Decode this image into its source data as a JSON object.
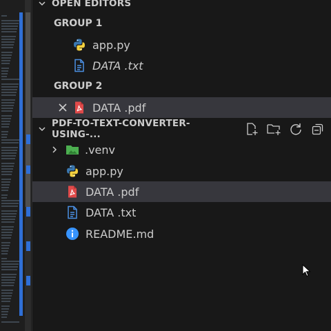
{
  "open_editors": {
    "title": "OPEN EDITORS",
    "groups": [
      {
        "label": "GROUP 1",
        "files": [
          {
            "name": "app.py"
          },
          {
            "name": "DATA .txt"
          }
        ]
      },
      {
        "label": "GROUP 2",
        "files": [
          {
            "name": "DATA .pdf"
          }
        ]
      }
    ]
  },
  "project": {
    "title": "PDF-TO-TEXT-CONVERTER-USING-...",
    "actions": [
      "new-file-icon",
      "new-folder-icon",
      "refresh-icon",
      "collapse-all-icon"
    ],
    "items": [
      {
        "name": ".venv",
        "icon": "folder-icon"
      },
      {
        "name": "app.py",
        "icon": "python-icon"
      },
      {
        "name": "DATA .pdf",
        "icon": "pdf-icon"
      },
      {
        "name": "DATA .txt",
        "icon": "text-file-icon"
      },
      {
        "name": "README.md",
        "icon": "info-icon"
      }
    ]
  },
  "colors": {
    "selected_row": "#37373d",
    "folder": "#4caf50",
    "pdf": "#e04a4a",
    "info": "#3794ff",
    "python_blue": "#3b78b0",
    "python_yellow": "#f4d03f"
  }
}
